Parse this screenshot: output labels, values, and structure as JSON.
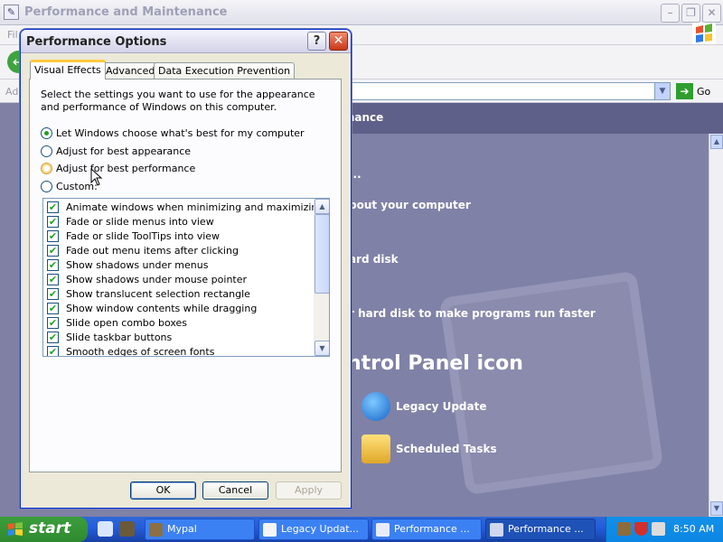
{
  "background_window": {
    "title": "Performance and Maintenance",
    "menu_partial": "Fil",
    "address_label_partial": "Add",
    "go_label": "Go",
    "header_partial": "tenance",
    "task_texts": [
      "...",
      "bout your computer",
      "ard disk",
      "r hard disk to make programs run faster"
    ],
    "control_panel_icon_title": "ntrol Panel icon",
    "control_panel_items": [
      {
        "label": "Legacy Update",
        "icon": "legacy-update-icon"
      },
      {
        "label": "Scheduled Tasks",
        "icon": "scheduled-tasks-icon"
      }
    ]
  },
  "dialog": {
    "title": "Performance Options",
    "help": "?",
    "close": "✕",
    "tabs": [
      {
        "label": "Visual Effects",
        "active": true
      },
      {
        "label": "Advanced",
        "active": false
      },
      {
        "label": "Data Execution Prevention",
        "active": false
      }
    ],
    "description": "Select the settings you want to use for the appearance and performance of Windows on this computer.",
    "options": [
      {
        "label": "Let Windows choose what's best for my computer",
        "selected": true
      },
      {
        "label": "Adjust for best appearance",
        "selected": false
      },
      {
        "label": "Adjust for best performance",
        "selected": false
      },
      {
        "label": "Custom:",
        "selected": false
      }
    ],
    "effects": [
      {
        "label": "Animate windows when minimizing and maximizing",
        "checked": true
      },
      {
        "label": "Fade or slide menus into view",
        "checked": true
      },
      {
        "label": "Fade or slide ToolTips into view",
        "checked": true
      },
      {
        "label": "Fade out menu items after clicking",
        "checked": true
      },
      {
        "label": "Show shadows under menus",
        "checked": true
      },
      {
        "label": "Show shadows under mouse pointer",
        "checked": true
      },
      {
        "label": "Show translucent selection rectangle",
        "checked": true
      },
      {
        "label": "Show window contents while dragging",
        "checked": true
      },
      {
        "label": "Slide open combo boxes",
        "checked": true
      },
      {
        "label": "Slide taskbar buttons",
        "checked": true
      },
      {
        "label": "Smooth edges of screen fonts",
        "checked": true
      }
    ],
    "buttons": {
      "ok": "OK",
      "cancel": "Cancel",
      "apply": "Apply"
    }
  },
  "taskbar": {
    "start_label": "start",
    "items": [
      {
        "label": "Mypal",
        "active": false
      },
      {
        "label": "Legacy Updat...",
        "active": false
      },
      {
        "label": "Performance ...",
        "active": false
      },
      {
        "label": "Performance ...",
        "active": true
      }
    ],
    "clock": "8:50 AM"
  },
  "colors": {
    "accent": "#0831d9",
    "check": "#21a121",
    "taskbar": "#245edb",
    "start": "#3c9e3c"
  }
}
